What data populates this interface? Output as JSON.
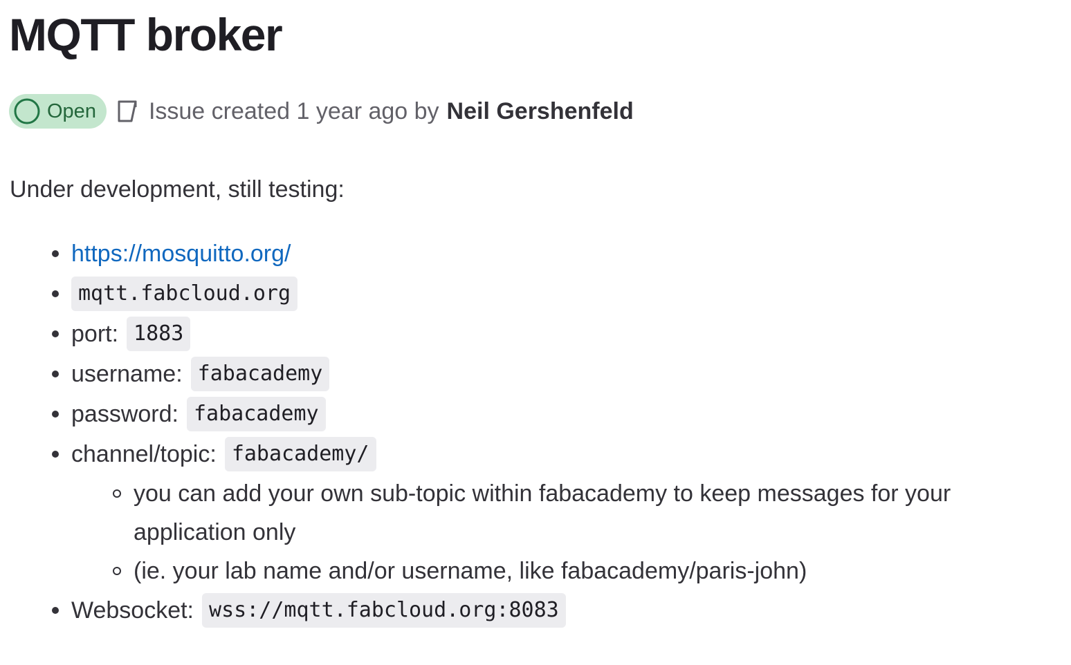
{
  "issue": {
    "title": "MQTT broker",
    "status": "Open",
    "meta_text": "Issue created 1 year ago by",
    "author": "Neil Gershenfeld"
  },
  "description": {
    "intro": "Under development, still testing:",
    "items": [
      {
        "link": "https://mosquitto.org/"
      },
      {
        "code": "mqtt.fabcloud.org"
      },
      {
        "label": "port:",
        "code": "1883"
      },
      {
        "label": "username:",
        "code": "fabacademy"
      },
      {
        "label": "password:",
        "code": "fabacademy"
      },
      {
        "label": "channel/topic:",
        "code": "fabacademy/",
        "subitems": [
          "you can add your own sub-topic within fabacademy to keep messages for your application only",
          "(ie. your lab name and/or username, like fabacademy/paris-john)"
        ]
      },
      {
        "label": "Websocket:",
        "code": "wss://mqtt.fabcloud.org:8083"
      }
    ]
  },
  "colors": {
    "status_bg": "#c3e6cd",
    "status_fg": "#24663b",
    "link": "#1068bf",
    "code_bg": "#ececef"
  },
  "icons": {
    "status": "issue-open-icon",
    "meta": "issue-type-icon"
  }
}
